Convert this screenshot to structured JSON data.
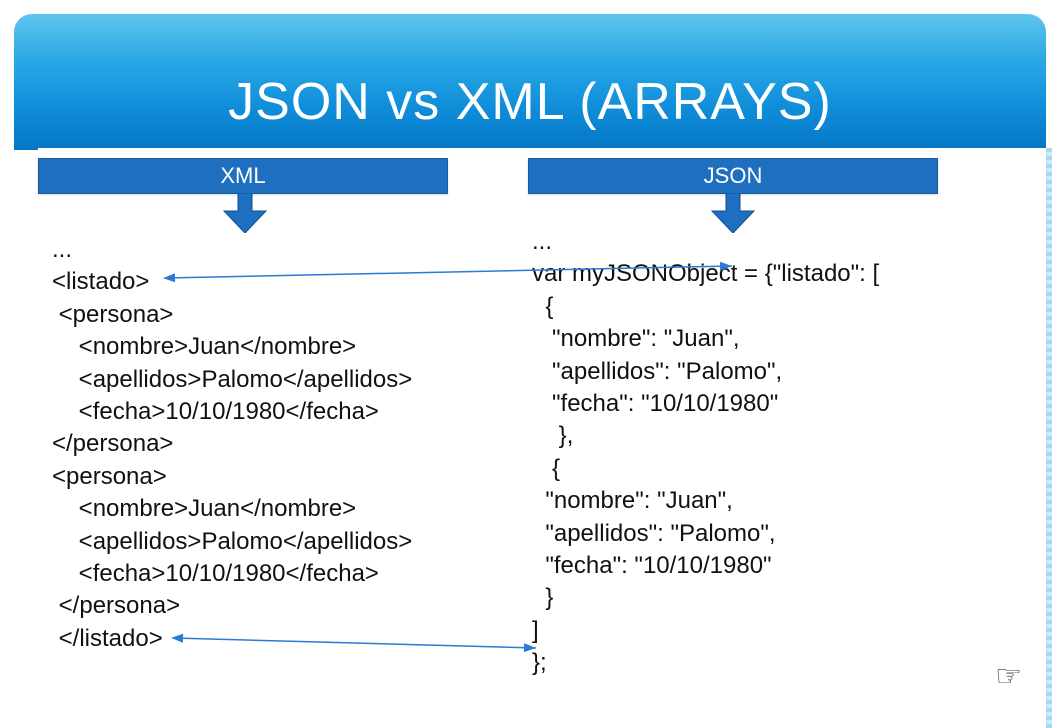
{
  "title": "JSON vs XML (ARRAYS)",
  "headers": {
    "xml": "XML",
    "json": "JSON"
  },
  "code": {
    "xml": "...\n<listado>\n <persona>\n    <nombre>Juan</nombre>\n    <apellidos>Palomo</apellidos>\n    <fecha>10/10/1980</fecha>\n</persona>\n<persona>\n    <nombre>Juan</nombre>\n    <apellidos>Palomo</apellidos>\n    <fecha>10/10/1980</fecha>\n </persona>\n </listado>",
    "json": "...\nvar myJSONObject = {\"listado\": [\n  {\n   \"nombre\": \"Juan\",\n   \"apellidos\": \"Palomo\",\n   \"fecha\": \"10/10/1980\"\n    },\n   {\n  \"nombre\": \"Juan\",\n  \"apellidos\": \"Palomo\",\n  \"fecha\": \"10/10/1980\"\n  }\n]\n};"
  },
  "colors": {
    "header_blue": "#1f6fc1",
    "band_top": "#5ec4ee",
    "band_bottom": "#0477c6",
    "connector": "#2b7bd4"
  },
  "icons": {
    "pointer": "☞"
  }
}
